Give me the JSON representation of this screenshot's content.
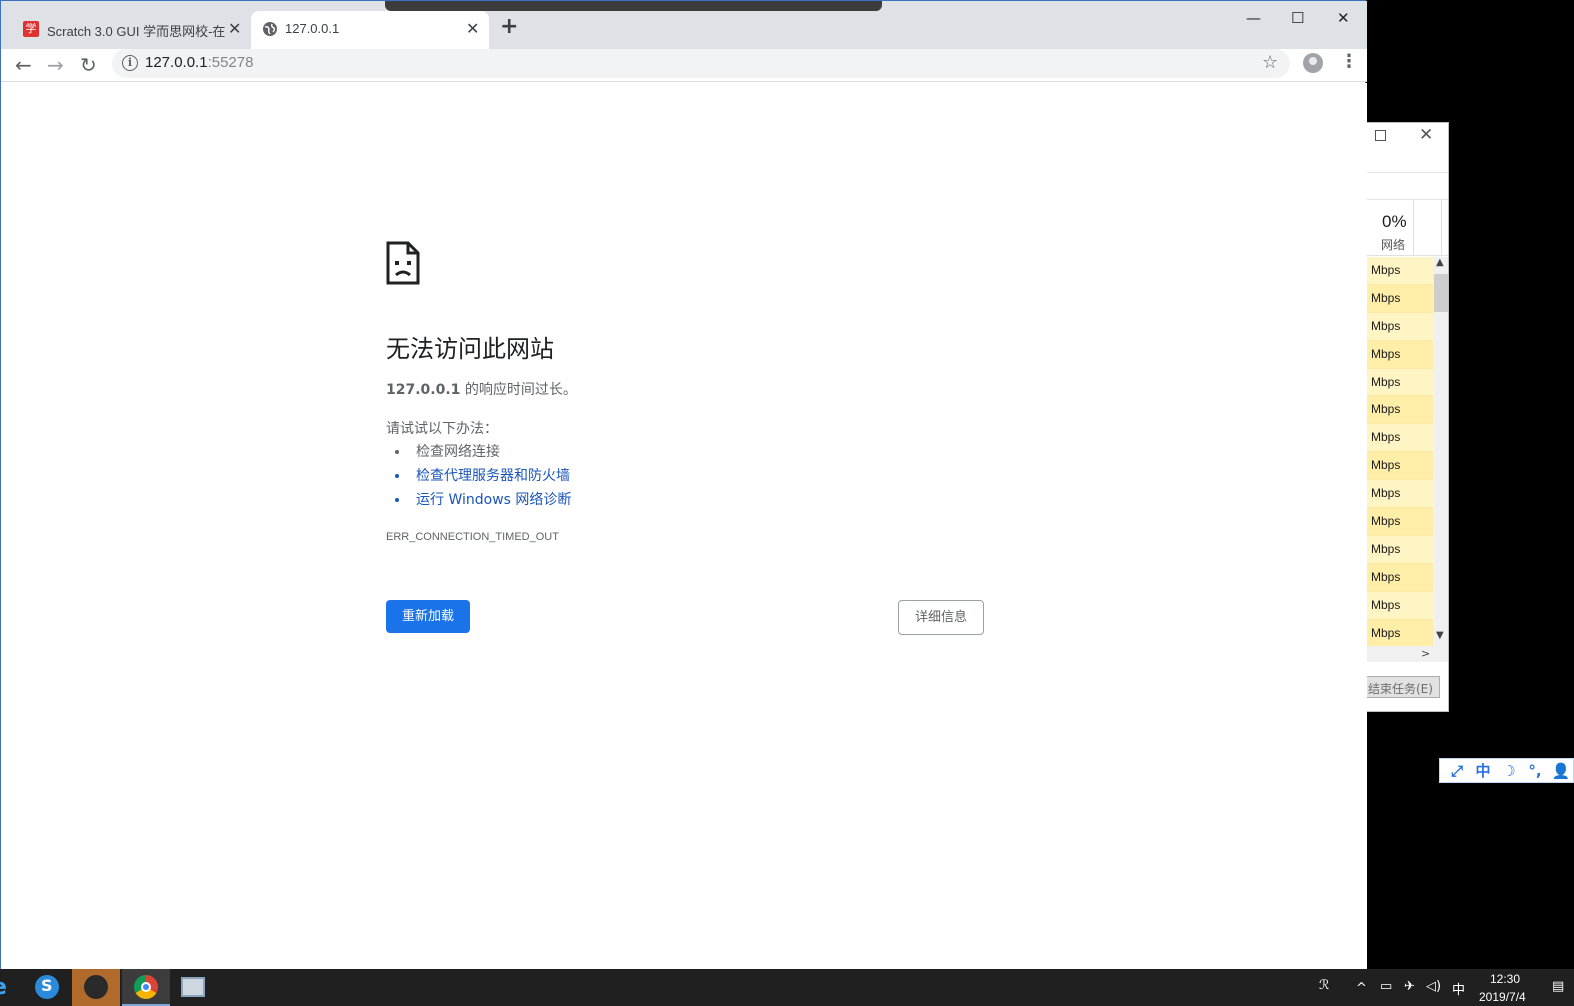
{
  "browser": {
    "tabs": [
      {
        "title": "Scratch 3.0 GUI 学而思网校-在",
        "favicon": "学"
      },
      {
        "title": "127.0.0.1"
      }
    ],
    "newtab_label": "+",
    "window_controls": {
      "minimize": "—",
      "maximize": "☐",
      "close": "✕"
    },
    "toolbar": {
      "back": "←",
      "forward": "→",
      "reload": "↻",
      "url_host": "127.0.0.1",
      "url_port": ":55278",
      "info": "i",
      "star": "☆",
      "menu": "⋮"
    }
  },
  "error_page": {
    "title": "无法访问此网站",
    "summary_host": "127.0.0.1",
    "summary_rest": " 的响应时间过长。",
    "try_label": "请试试以下办法：",
    "suggestions": [
      {
        "text": "检查网络连接",
        "link": false
      },
      {
        "text": "检查代理服务器和防火墙",
        "link": true
      },
      {
        "text": "运行 Windows 网络诊断",
        "link": true
      }
    ],
    "error_code": "ERR_CONNECTION_TIMED_OUT",
    "reload_button": "重新加载",
    "details_button": "详细信息",
    "icon": "sad-page-icon"
  },
  "task_manager": {
    "close": "✕",
    "network_pct": "0%",
    "network_label": "网络",
    "rows": [
      "Mbps",
      "Mbps",
      "Mbps",
      "Mbps",
      "Mbps",
      "Mbps",
      "Mbps",
      "Mbps",
      "Mbps",
      "Mbps",
      "Mbps",
      "Mbps",
      "Mbps",
      "Mbps"
    ],
    "scroll_up": "▲",
    "scroll_down": "▼",
    "scroll_right": ">",
    "end_task": "结束任务(E)"
  },
  "ime_bar": {
    "items": [
      "⤢",
      "中",
      "☽",
      "°,",
      "👤"
    ]
  },
  "taskbar": {
    "edge": "e",
    "sogou": "S",
    "tray": {
      "people": "ℛ",
      "chevron": "^",
      "network": "▭",
      "sogou_tray": "✈",
      "volume": "◁)",
      "ime": "中",
      "notifications": "▤"
    },
    "clock_time": "12:30",
    "clock_date": "2019/7/4"
  },
  "colors": {
    "accent": "#1a73e8",
    "link": "#1a55b8",
    "taskbar": "#202020",
    "tabstrip": "#dee1e6"
  }
}
